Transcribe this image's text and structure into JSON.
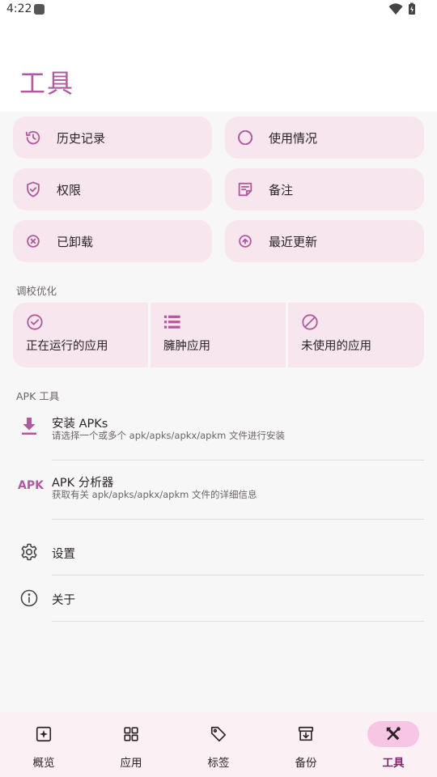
{
  "status_bar": {
    "time": "4:22"
  },
  "page": {
    "title": "工具"
  },
  "quick_actions": [
    {
      "label": "历史记录",
      "icon": "history-icon"
    },
    {
      "label": "使用情况",
      "icon": "usage-icon"
    },
    {
      "label": "权限",
      "icon": "shield-icon"
    },
    {
      "label": "备注",
      "icon": "note-icon"
    },
    {
      "label": "已卸载",
      "icon": "uninstalled-icon"
    },
    {
      "label": "最近更新",
      "icon": "update-icon"
    }
  ],
  "optimization": {
    "title": "调校优化",
    "items": [
      {
        "label": "正在运行的应用",
        "icon": "check-circle-icon"
      },
      {
        "label": "臃肿应用",
        "icon": "list-icon"
      },
      {
        "label": "未使用的应用",
        "icon": "block-icon"
      }
    ]
  },
  "apk_tools": {
    "title": "APK 工具",
    "items": [
      {
        "title": "安装 APKs",
        "subtitle": "请选择一个或多个 apk/apks/apkx/apkm 文件进行安装",
        "icon": "install-icon"
      },
      {
        "title": "APK 分析器",
        "subtitle": "获取有关 apk/apks/apkx/apkm 文件的详细信息",
        "icon": "apk-icon",
        "icon_text": "APK"
      }
    ]
  },
  "misc": [
    {
      "label": "设置",
      "icon": "gear-icon"
    },
    {
      "label": "关于",
      "icon": "info-icon"
    }
  ],
  "bottom_nav": [
    {
      "label": "概览",
      "icon": "overview-icon",
      "active": false
    },
    {
      "label": "应用",
      "icon": "apps-icon",
      "active": false
    },
    {
      "label": "标签",
      "icon": "tag-icon",
      "active": false
    },
    {
      "label": "备份",
      "icon": "backup-icon",
      "active": false
    },
    {
      "label": "工具",
      "icon": "tools-icon",
      "active": true
    }
  ],
  "colors": {
    "accent": "#b05a9e",
    "card": "#f7e6ee",
    "nav_active": "#f6c6e4",
    "nav_active_text": "#7b2a68"
  }
}
